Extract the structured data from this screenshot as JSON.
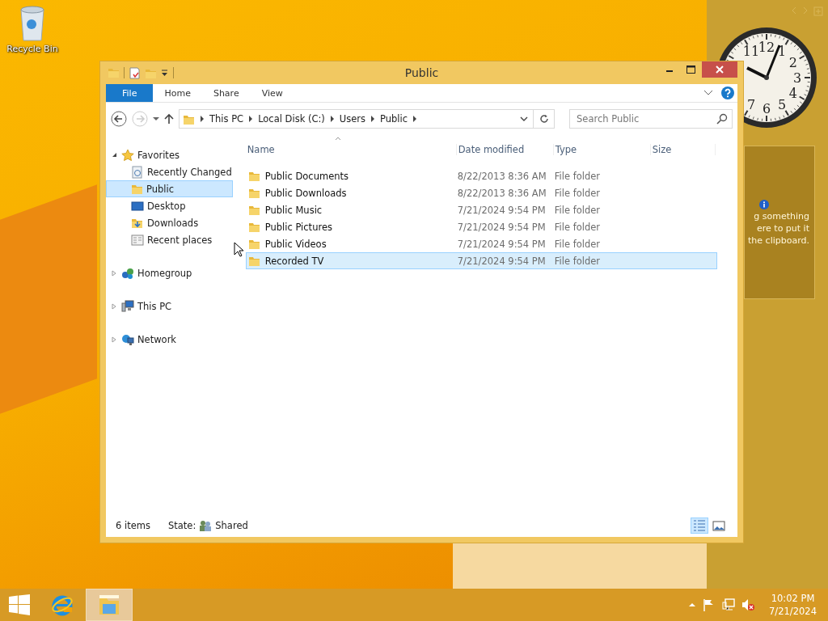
{
  "desktop_icons": [
    {
      "label": "Recycle Bin"
    }
  ],
  "gadgets": {
    "clock": {
      "numerals": [
        "11",
        "12",
        "1",
        "2",
        "3",
        "4",
        "5",
        "6",
        "7"
      ]
    },
    "clipboard": {
      "lines": [
        "g something",
        "ere to put it",
        "the clipboard."
      ]
    }
  },
  "window": {
    "title": "Public",
    "file_tab": "File",
    "ribbon_tabs": [
      "Home",
      "Share",
      "View"
    ],
    "breadcrumb": [
      "This PC",
      "Local Disk (C:)",
      "Users",
      "Public"
    ],
    "search": {
      "placeholder": "Search Public"
    },
    "nav": [
      {
        "label": "Favorites",
        "kind": "favorites",
        "expanded": true,
        "selected": false,
        "children": [
          {
            "label": "Recently Changed",
            "kind": "recent",
            "selected": false
          },
          {
            "label": "Public",
            "kind": "folder",
            "selected": true
          },
          {
            "label": "Desktop",
            "kind": "desktop",
            "selected": false
          },
          {
            "label": "Downloads",
            "kind": "downloads",
            "selected": false
          },
          {
            "label": "Recent places",
            "kind": "places",
            "selected": false
          }
        ]
      },
      {
        "label": "Homegroup",
        "kind": "homegroup",
        "expanded": false,
        "selected": false
      },
      {
        "label": "This PC",
        "kind": "pc",
        "expanded": false,
        "selected": false
      },
      {
        "label": "Network",
        "kind": "network",
        "expanded": false,
        "selected": false
      }
    ],
    "columns": [
      "Name",
      "Date modified",
      "Type",
      "Size"
    ],
    "rows": [
      {
        "name": "Public Documents",
        "date": "8/22/2013 8:36 AM",
        "type": "File folder",
        "selected": false
      },
      {
        "name": "Public Downloads",
        "date": "8/22/2013 8:36 AM",
        "type": "File folder",
        "selected": false
      },
      {
        "name": "Public Music",
        "date": "7/21/2024 9:54 PM",
        "type": "File folder",
        "selected": false
      },
      {
        "name": "Public Pictures",
        "date": "7/21/2024 9:54 PM",
        "type": "File folder",
        "selected": false
      },
      {
        "name": "Public Videos",
        "date": "7/21/2024 9:54 PM",
        "type": "File folder",
        "selected": false
      },
      {
        "name": "Recorded TV",
        "date": "7/21/2024 9:54 PM",
        "type": "File folder",
        "selected": true
      }
    ],
    "status": {
      "count": "6 items",
      "state_label": "State:",
      "state_value": "Shared"
    },
    "view_buttons": [
      {
        "kind": "details",
        "selected": true
      },
      {
        "kind": "tiles",
        "selected": false
      }
    ]
  },
  "taskbar": {
    "apps": [
      {
        "kind": "browser",
        "active": false
      },
      {
        "kind": "explorer",
        "active": true
      }
    ],
    "time": "10:02 PM",
    "date": "7/21/2024"
  }
}
